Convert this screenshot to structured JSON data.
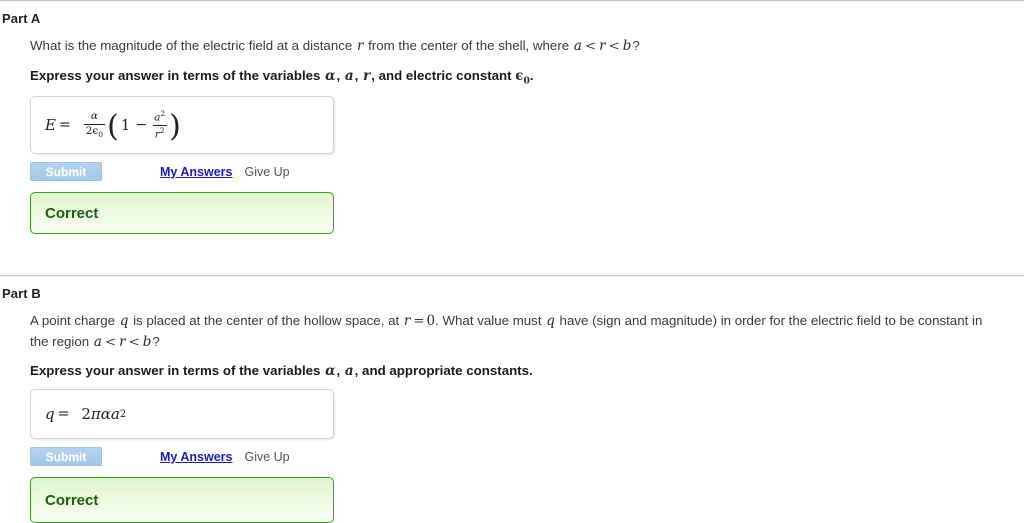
{
  "parts": [
    {
      "title": "Part A",
      "question_prefix": "What is the magnitude of the electric field at a distance ",
      "question_var_r": "r",
      "question_mid": " from the center of the shell, where ",
      "question_ineq_a": "a",
      "question_lt1": "<",
      "question_ineq_r": "r",
      "question_lt2": "<",
      "question_ineq_b": "b",
      "question_suffix": "?",
      "instruction_prefix": "Express your answer in terms of the variables ",
      "instruction_var1": "α",
      "instruction_sep1": ", ",
      "instruction_var2": "a",
      "instruction_sep2": ", ",
      "instruction_var3": "r",
      "instruction_mid": ", and electric constant ",
      "instruction_const": "ϵ",
      "instruction_const_sub": "0",
      "instruction_suffix": ".",
      "answer": {
        "label": "E",
        "equals": "=",
        "expression_plain": "α/(2ϵ₀)(1 − a²/r²)",
        "frac1_num": "α",
        "frac1_den_coef": "2",
        "frac1_den_sym": "ϵ",
        "frac1_den_sub": "0",
        "paren_open": "(",
        "one": "1",
        "minus": "−",
        "frac2_num_sym": "a",
        "frac2_num_exp": "2",
        "frac2_den_sym": "r",
        "frac2_den_exp": "2",
        "paren_close": ")"
      },
      "submit_label": "Submit",
      "my_answers_label": "My Answers",
      "give_up_label": "Give Up",
      "feedback_label": "Correct"
    },
    {
      "title": "Part B",
      "q_t1": "A point charge ",
      "q_v1": "q",
      "q_t2": " is placed at the center of the hollow space, at ",
      "q_v2": "r",
      "q_eq": "=",
      "q_v3": "0",
      "q_t3": ". What value must ",
      "q_v4": "q",
      "q_t4": " have (sign and magnitude) in order for the electric field to be constant in the region ",
      "q_v5": "a",
      "q_lt1": "<",
      "q_v6": "r",
      "q_lt2": "<",
      "q_v7": "b",
      "q_t5": "?",
      "instruction_prefix": "Express your answer in terms of the variables ",
      "instruction_var1": "α",
      "instruction_sep1": ", ",
      "instruction_var2": "a",
      "instruction_mid": ", and appropriate constants.",
      "answer": {
        "label": "q",
        "equals": "=",
        "expression_plain": "2παa²",
        "coef": "2",
        "pi": "π",
        "alpha": "α",
        "var_a": "a",
        "exp": "2"
      },
      "submit_label": "Submit",
      "my_answers_label": "My Answers",
      "give_up_label": "Give Up",
      "feedback_label": "Correct"
    }
  ],
  "colors": {
    "submit_button": "#a8cced",
    "link": "#1a1ad0",
    "feedback_border": "#3ba11e",
    "feedback_text": "#16640b",
    "feedback_bg": "#e6f7d9",
    "rule": "#c9c9c9"
  }
}
